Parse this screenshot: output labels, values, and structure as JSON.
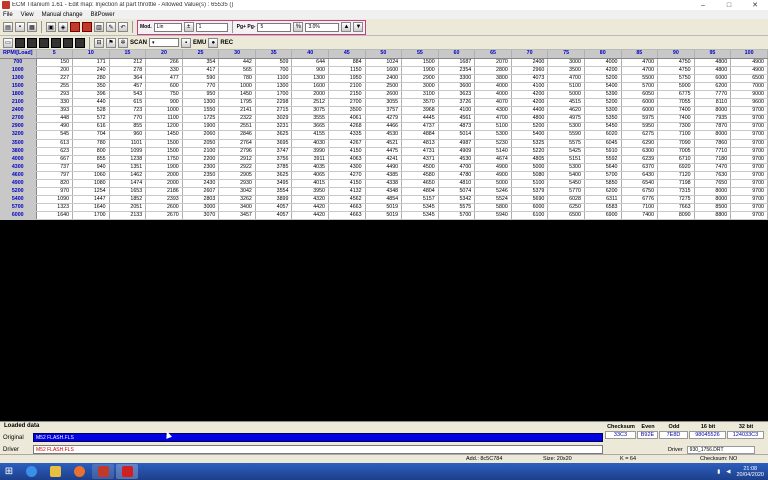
{
  "window": {
    "title": "ECM Titanium 1.61 - Edit map: Injection at part throttle - Allowed Value(s) : 65535 ()",
    "controls": [
      "–",
      "□",
      "✕"
    ]
  },
  "menu": [
    "File",
    "View",
    "Manual change",
    "BitPower"
  ],
  "toolbar": {
    "mod_label": "Mod.",
    "mod_value": "Lin",
    "step_value": "1",
    "pg_label": "Pg+ Pg-",
    "pg_value": "5",
    "pct_value": "3.0%",
    "scan_label": "SCAN",
    "emu_label": "EMU",
    "rec_label": "REC"
  },
  "map": {
    "corner": "RPM\\[Load]",
    "columns": [
      "5",
      "10",
      "15",
      "20",
      "25",
      "30",
      "35",
      "40",
      "45",
      "50",
      "55",
      "60",
      "65",
      "70",
      "75",
      "80",
      "85",
      "90",
      "95",
      "100"
    ],
    "rows": [
      {
        "rpm": "700",
        "v": [
          "150",
          "171",
          "212",
          "266",
          "354",
          "442",
          "509",
          "644",
          "884",
          "1024",
          "1500",
          "1687",
          "2070",
          "2400",
          "3000",
          "4000",
          "4700",
          "4750",
          "4800",
          "4900"
        ]
      },
      {
        "rpm": "1000",
        "v": [
          "200",
          "240",
          "278",
          "330",
          "417",
          "565",
          "700",
          "900",
          "1150",
          "1600",
          "1900",
          "2354",
          "2800",
          "2960",
          "3500",
          "4200",
          "4700",
          "4750",
          "4800",
          "4900"
        ]
      },
      {
        "rpm": "1300",
        "v": [
          "227",
          "280",
          "364",
          "477",
          "590",
          "780",
          "1100",
          "1300",
          "1950",
          "2400",
          "2900",
          "3300",
          "3800",
          "4073",
          "4700",
          "5200",
          "5500",
          "5750",
          "6000",
          "6500"
        ]
      },
      {
        "rpm": "1500",
        "v": [
          "255",
          "350",
          "457",
          "600",
          "770",
          "1000",
          "1300",
          "1600",
          "2100",
          "2500",
          "3000",
          "3600",
          "4000",
          "4100",
          "5100",
          "5400",
          "5700",
          "5900",
          "6200",
          "7000"
        ]
      },
      {
        "rpm": "1800",
        "v": [
          "293",
          "396",
          "543",
          "750",
          "950",
          "1450",
          "1700",
          "2000",
          "2150",
          "2600",
          "3100",
          "3623",
          "4000",
          "4200",
          "5000",
          "5390",
          "6050",
          "6775",
          "7770",
          "9000"
        ]
      },
      {
        "rpm": "2100",
        "v": [
          "330",
          "440",
          "615",
          "900",
          "1300",
          "1795",
          "2298",
          "2512",
          "2700",
          "3055",
          "3570",
          "3726",
          "4070",
          "4200",
          "4515",
          "5200",
          "6000",
          "7055",
          "8110",
          "9600"
        ]
      },
      {
        "rpm": "2400",
        "v": [
          "393",
          "528",
          "723",
          "1000",
          "1550",
          "2141",
          "2715",
          "3075",
          "3500",
          "3757",
          "3968",
          "4100",
          "4300",
          "4400",
          "4620",
          "5300",
          "6000",
          "7400",
          "8000",
          "9700"
        ]
      },
      {
        "rpm": "2700",
        "v": [
          "448",
          "572",
          "770",
          "1100",
          "1725",
          "2322",
          "3029",
          "3555",
          "4061",
          "4279",
          "4445",
          "4561",
          "4700",
          "4800",
          "4975",
          "5350",
          "5975",
          "7400",
          "7935",
          "9700"
        ]
      },
      {
        "rpm": "2900",
        "v": [
          "490",
          "616",
          "855",
          "1200",
          "1900",
          "2551",
          "3231",
          "3665",
          "4268",
          "4466",
          "4737",
          "4873",
          "5100",
          "5200",
          "5300",
          "5450",
          "5950",
          "7300",
          "7870",
          "9700"
        ]
      },
      {
        "rpm": "3200",
        "v": [
          "545",
          "704",
          "960",
          "1450",
          "2060",
          "2846",
          "3625",
          "4155",
          "4335",
          "4530",
          "4884",
          "5014",
          "5300",
          "5400",
          "5590",
          "6020",
          "6275",
          "7100",
          "8000",
          "9700"
        ]
      },
      {
        "rpm": "3500",
        "v": [
          "613",
          "780",
          "1101",
          "1500",
          "2050",
          "2764",
          "3695",
          "4030",
          "4267",
          "4521",
          "4813",
          "4987",
          "5230",
          "5325",
          "5575",
          "6045",
          "6290",
          "7090",
          "7860",
          "9700"
        ]
      },
      {
        "rpm": "3800",
        "v": [
          "623",
          "800",
          "1099",
          "1500",
          "2100",
          "2796",
          "3747",
          "3990",
          "4150",
          "4475",
          "4731",
          "4909",
          "5140",
          "5220",
          "5425",
          "5910",
          "6300",
          "7005",
          "7710",
          "9700"
        ]
      },
      {
        "rpm": "4000",
        "v": [
          "667",
          "855",
          "1238",
          "1750",
          "2200",
          "2912",
          "3756",
          "3911",
          "4063",
          "4241",
          "4371",
          "4530",
          "4674",
          "4805",
          "5151",
          "5592",
          "6239",
          "6710",
          "7180",
          "9700"
        ]
      },
      {
        "rpm": "4300",
        "v": [
          "737",
          "940",
          "1351",
          "1900",
          "2300",
          "2922",
          "3785",
          "4035",
          "4300",
          "4490",
          "4500",
          "4700",
          "4900",
          "5000",
          "5300",
          "5640",
          "6370",
          "6920",
          "7470",
          "9700"
        ]
      },
      {
        "rpm": "4600",
        "v": [
          "797",
          "1060",
          "1462",
          "2000",
          "2350",
          "2905",
          "3625",
          "4065",
          "4270",
          "4385",
          "4580",
          "4780",
          "4900",
          "5080",
          "5400",
          "5700",
          "6430",
          "7120",
          "7630",
          "9700"
        ]
      },
      {
        "rpm": "4900",
        "v": [
          "820",
          "1080",
          "1474",
          "2000",
          "2430",
          "2930",
          "3495",
          "4015",
          "4150",
          "4338",
          "4650",
          "4810",
          "5000",
          "5100",
          "5450",
          "5850",
          "6540",
          "7198",
          "7650",
          "9700"
        ]
      },
      {
        "rpm": "5200",
        "v": [
          "970",
          "1254",
          "1653",
          "2186",
          "2607",
          "3042",
          "3554",
          "3950",
          "4132",
          "4348",
          "4804",
          "5074",
          "5246",
          "5379",
          "5770",
          "6200",
          "6750",
          "7315",
          "8000",
          "9700"
        ]
      },
      {
        "rpm": "5400",
        "v": [
          "1090",
          "1447",
          "1852",
          "2393",
          "2803",
          "3262",
          "3899",
          "4320",
          "4562",
          "4854",
          "5157",
          "5342",
          "5524",
          "5690",
          "6028",
          "6311",
          "6776",
          "7275",
          "8000",
          "9700"
        ]
      },
      {
        "rpm": "5700",
        "v": [
          "1323",
          "1640",
          "2051",
          "2600",
          "3000",
          "3400",
          "4057",
          "4420",
          "4663",
          "5019",
          "5345",
          "5575",
          "5800",
          "6000",
          "6250",
          "6583",
          "7100",
          "7663",
          "8500",
          "9700"
        ]
      },
      {
        "rpm": "6000",
        "v": [
          "1640",
          "1700",
          "2133",
          "2670",
          "3070",
          "3457",
          "4057",
          "4420",
          "4663",
          "5019",
          "5345",
          "5700",
          "5940",
          "6100",
          "6500",
          "6900",
          "7400",
          "8090",
          "8800",
          "9700"
        ]
      }
    ]
  },
  "status": {
    "title": "Loaded data",
    "original_label": "Original",
    "original_value": "M52 FLASH.FLS",
    "driver_label": "Driver",
    "driver_value": "M52 FLASH.FLS",
    "checksum_headers": [
      "Checksum",
      "Even",
      "Odd",
      "16 bit",
      "32 bit"
    ],
    "checksum_values": [
      "33C3",
      "B92E",
      "7E8D",
      "98045526",
      "124033C3"
    ],
    "driver2_label": "Driver",
    "driver2_value": "930_1756.DRT"
  },
  "infobar": {
    "addr": "Add.: 8c5C784",
    "size": "Size: 20x20",
    "k": "K = 64",
    "checksum": "Checksum: NO"
  },
  "taskbar": {
    "time": "21:08",
    "date": "20/04/2020"
  }
}
